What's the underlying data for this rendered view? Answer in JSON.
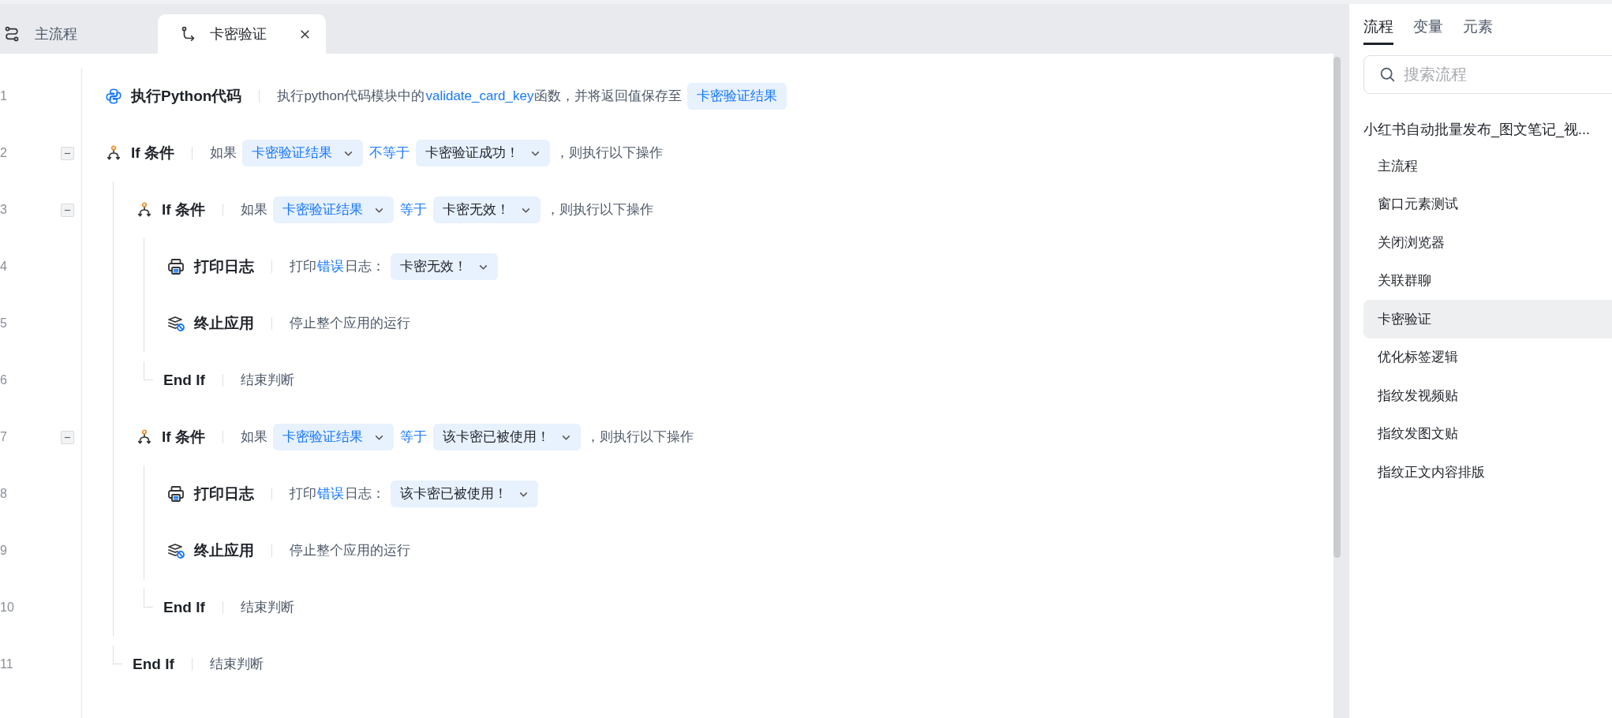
{
  "editor_tabs": [
    {
      "label": "主流程",
      "selected": false,
      "closable": false
    },
    {
      "label": "卡密验证",
      "selected": true,
      "closable": true
    }
  ],
  "steps": [
    {
      "line": "1",
      "kind": "python",
      "title": "执行Python代码",
      "desc": [
        {
          "kind": "text",
          "text": "执行python代码模块中的"
        },
        {
          "kind": "keyword",
          "text": "validate_card_key"
        },
        {
          "kind": "text",
          "text": "函数，并将返回值保存至"
        },
        {
          "kind": "variable",
          "text": "卡密验证结果",
          "dropdown": false
        }
      ]
    },
    {
      "line": "2",
      "kind": "if",
      "title": "If 条件",
      "expanded": true,
      "desc": [
        {
          "kind": "text",
          "text": "如果"
        },
        {
          "kind": "variable",
          "text": "卡密验证结果",
          "dropdown": true
        },
        {
          "kind": "keyword",
          "text": "不等于"
        },
        {
          "kind": "value",
          "text": "卡密验证成功！",
          "dropdown": true
        },
        {
          "kind": "text",
          "text": "，则执行以下操作"
        }
      ],
      "children": [
        {
          "line": "3",
          "kind": "if",
          "title": "If 条件",
          "expanded": true,
          "desc": [
            {
              "kind": "text",
              "text": "如果"
            },
            {
              "kind": "variable",
              "text": "卡密验证结果",
              "dropdown": true
            },
            {
              "kind": "keyword",
              "text": "等于"
            },
            {
              "kind": "value",
              "text": "卡密无效！",
              "dropdown": true
            },
            {
              "kind": "text",
              "text": "，则执行以下操作"
            }
          ],
          "children": [
            {
              "line": "4",
              "kind": "log",
              "title": "打印日志",
              "desc": [
                {
                  "kind": "text",
                  "text": "打印"
                },
                {
                  "kind": "keyword",
                  "text": "错误"
                },
                {
                  "kind": "text",
                  "text": "日志："
                },
                {
                  "kind": "value",
                  "text": "卡密无效！",
                  "dropdown": true
                }
              ]
            },
            {
              "line": "5",
              "kind": "stop",
              "title": "终止应用",
              "desc": [
                {
                  "kind": "text",
                  "text": "停止整个应用的运行"
                }
              ]
            }
          ],
          "end": {
            "line": "6",
            "title": "End If",
            "desc": "结束判断"
          }
        },
        {
          "line": "7",
          "kind": "if",
          "title": "If 条件",
          "expanded": true,
          "desc": [
            {
              "kind": "text",
              "text": "如果"
            },
            {
              "kind": "variable",
              "text": "卡密验证结果",
              "dropdown": true
            },
            {
              "kind": "keyword",
              "text": "等于"
            },
            {
              "kind": "value",
              "text": "该卡密已被使用！",
              "dropdown": true
            },
            {
              "kind": "text",
              "text": "，则执行以下操作"
            }
          ],
          "children": [
            {
              "line": "8",
              "kind": "log",
              "title": "打印日志",
              "desc": [
                {
                  "kind": "text",
                  "text": "打印"
                },
                {
                  "kind": "keyword",
                  "text": "错误"
                },
                {
                  "kind": "text",
                  "text": "日志："
                },
                {
                  "kind": "value",
                  "text": "该卡密已被使用！",
                  "dropdown": true
                }
              ]
            },
            {
              "line": "9",
              "kind": "stop",
              "title": "终止应用",
              "desc": [
                {
                  "kind": "text",
                  "text": "停止整个应用的运行"
                }
              ]
            }
          ],
          "end": {
            "line": "10",
            "title": "End If",
            "desc": "结束判断"
          }
        }
      ],
      "end": {
        "line": "11",
        "title": "End If",
        "desc": "结束判断"
      }
    }
  ],
  "side_panel": {
    "tabs": [
      {
        "label": "流程",
        "selected": true
      },
      {
        "label": "变量",
        "selected": false
      },
      {
        "label": "元素",
        "selected": false
      }
    ],
    "search": {
      "placeholder": "搜索流程"
    },
    "project": {
      "title": "小红书自动批量发布_图文笔记_视...",
      "children": [
        {
          "label": "主流程",
          "selected": false
        },
        {
          "label": "窗口元素测试",
          "selected": false
        },
        {
          "label": "关闭浏览器",
          "selected": false
        },
        {
          "label": "关联群聊",
          "selected": false
        },
        {
          "label": "卡密验证",
          "selected": true
        },
        {
          "label": "优化标签逻辑",
          "selected": false
        },
        {
          "label": "指纹发视频贴",
          "selected": false
        },
        {
          "label": "指纹发图文贴",
          "selected": false
        },
        {
          "label": "指纹正文内容排版",
          "selected": false
        }
      ]
    }
  }
}
